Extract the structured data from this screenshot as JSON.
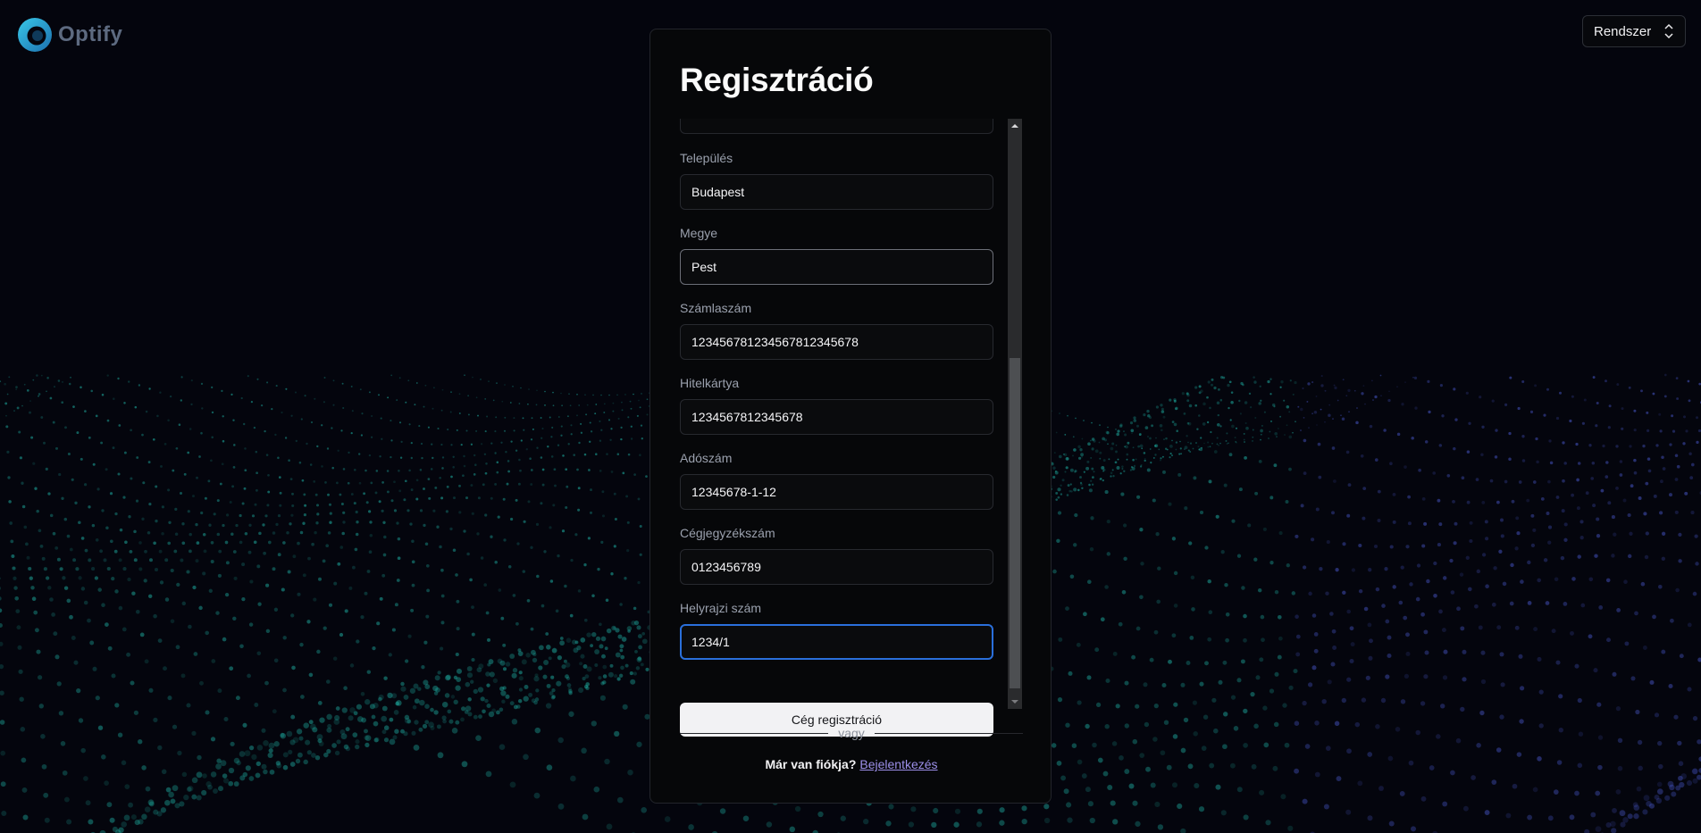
{
  "brand": {
    "name": "Optify"
  },
  "theme_select": {
    "value": "Rendszer"
  },
  "form": {
    "title": "Regisztráció",
    "fields": [
      {
        "label": "Település",
        "value": "Budapest"
      },
      {
        "label": "Megye",
        "value": "Pest"
      },
      {
        "label": "Számlaszám",
        "value": "123456781234567812345678"
      },
      {
        "label": "Hitelkártya",
        "value": "1234567812345678"
      },
      {
        "label": "Adószám",
        "value": "12345678-1-12"
      },
      {
        "label": "Cégjegyzékszám",
        "value": "0123456789"
      },
      {
        "label": "Helyrajzi szám",
        "value": "1234/1"
      }
    ],
    "submit_label": "Cég regisztráció",
    "divider_text": "vagy",
    "login_question": "Már van fiókja?",
    "login_link": "Bejelentkezés"
  },
  "colors": {
    "accent_focus": "#2a6fdb",
    "link": "#9c8fe9",
    "particles_teal": "#1fb5a8",
    "particles_blue": "#4a5ad0"
  }
}
